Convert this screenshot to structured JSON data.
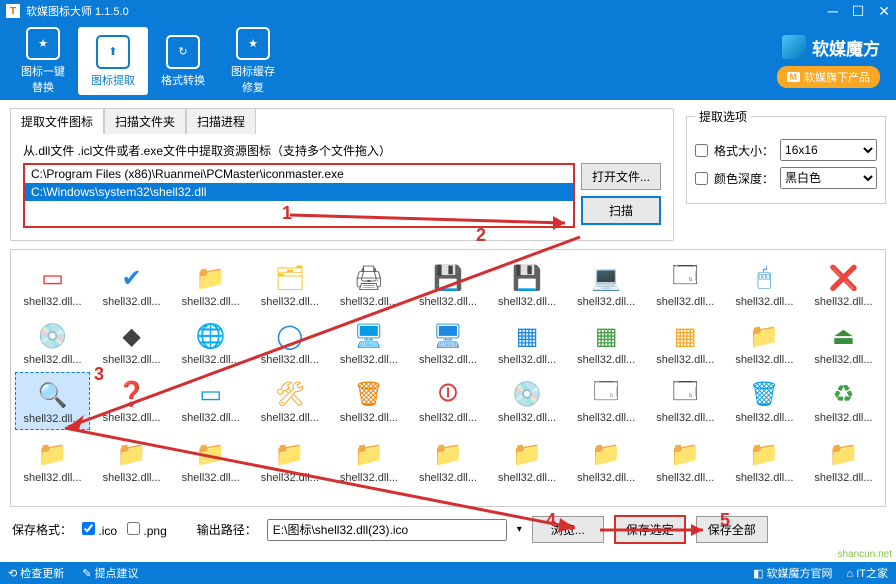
{
  "title": "软媒图标大师 1.1.5.0",
  "toolbar": [
    {
      "label": "图标一键\n替换",
      "glyph": "★"
    },
    {
      "label": "图标提取",
      "glyph": "⬆"
    },
    {
      "label": "格式转换",
      "glyph": "↻"
    },
    {
      "label": "图标缓存\n修复",
      "glyph": "★"
    }
  ],
  "brand": {
    "name": "软媒魔方",
    "badge": "软媒旗下产品"
  },
  "tabs": [
    "提取文件图标",
    "扫描文件夹",
    "扫描进程"
  ],
  "hint": "从.dll文件 .icl文件或者.exe文件中提取资源图标（支持多个文件拖入）",
  "files": [
    "C:\\Program Files (x86)\\Ruanmei\\PCMaster\\iconmaster.exe",
    "C:\\Windows\\system32\\shell32.dll"
  ],
  "open_label": "打开文件...",
  "scan_label": "扫描",
  "options": {
    "legend": "提取选项",
    "size_label": "格式大小：",
    "size_value": "16x16",
    "depth_label": "颜色深度：",
    "depth_value": "黑白色"
  },
  "icon_label": "shell32.dll...",
  "icon_rows": [
    [
      "#e53935:▭",
      "#1e88e5:✔",
      "#fbc02d:📁",
      "#fbc02d:🗂",
      "#616161:🖨",
      "#1e88e5:💾",
      "#1e88e5:💾",
      "#424242:💻",
      "#424242:🗔",
      "#1e88e5:🖱",
      "#f44336:❌"
    ],
    [
      "#9e9e9e:💿",
      "#424242:◆",
      "#1565c0:🌐",
      "#1e88e5:◯",
      "#039be5:🖥",
      "#1e88e5:🖥",
      "#1e88e5:▦",
      "#43a047:▦",
      "#f9a825:▦",
      "#fbc02d:📁",
      "#388e3c:⏏"
    ],
    [
      "#1e88e5:🔍",
      "#1e88e5:❓",
      "#039be5:▭",
      "#f9a825:🛠",
      "#f57c00:🗑",
      "#e53935:⏼",
      "#9e9e9e:💿",
      "#616161:🗔",
      "#424242:🗔",
      "#039be5:🗑",
      "#43a047:♻"
    ],
    [
      "#fbc02d:📁",
      "#fbc02d:📁",
      "#fbc02d:📁",
      "#fbc02d:📁",
      "#fbc02d:📁",
      "#fbc02d:📁",
      "#fbc02d:📁",
      "#fbc02d:📁",
      "#fbc02d:📁",
      "#fbc02d:📁",
      "#fbc02d:📁"
    ]
  ],
  "save": {
    "format_label": "保存格式：",
    "ico": ".ico",
    "png": ".png",
    "path_label": "输出路径：",
    "path_value": "E:\\图标\\shell32.dll(23).ico",
    "browse": "浏览...",
    "save_sel": "保存选定",
    "save_all": "保存全部"
  },
  "status": {
    "check": "检查更新",
    "suggest": "提点建议",
    "site1": "软媒魔方官网",
    "site2": "IT之家"
  },
  "annotations": [
    "1",
    "2",
    "3",
    "4",
    "5"
  ],
  "watermark": "shancun.net"
}
